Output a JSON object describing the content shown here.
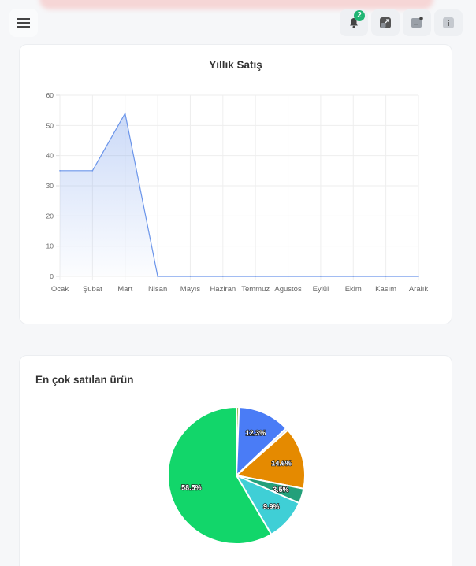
{
  "header": {
    "notification_count": "2",
    "icons": [
      "menu-icon",
      "bell-icon",
      "fullscreen-icon",
      "message-icon",
      "more-vertical-icon"
    ]
  },
  "line_card": {
    "title": "Yıllık Satış"
  },
  "pie_card": {
    "title": "En çok satılan ürün"
  },
  "colors": {
    "line": "#6b95ea",
    "grid": "#eeeeee",
    "axis_text": "#666666"
  },
  "chart_data": [
    {
      "type": "area",
      "title": "Yıllık Satış",
      "categories": [
        "Ocak",
        "Şubat",
        "Mart",
        "Nisan",
        "Mayıs",
        "Haziran",
        "Temmuz",
        "Agustos",
        "Eylül",
        "Ekim",
        "Kasım",
        "Aralık"
      ],
      "values": [
        35,
        35,
        54,
        0,
        0,
        0,
        0,
        0,
        0,
        0,
        0,
        0
      ],
      "ylim": [
        0,
        60
      ],
      "yticks": [
        0,
        10,
        20,
        30,
        40,
        50,
        60
      ],
      "grid": true,
      "legend": "none"
    },
    {
      "type": "pie",
      "title": "En çok satılan ürün",
      "slices": [
        {
          "value": 0.6,
          "label": "",
          "color": "#a2b85a"
        },
        {
          "value": 12.3,
          "label": "12.3%",
          "color": "#4a7cf6"
        },
        {
          "value": 0.6,
          "label": "",
          "color": "#e0e0e0"
        },
        {
          "value": 14.6,
          "label": "14.6%",
          "color": "#e58a00"
        },
        {
          "value": 3.5,
          "label": "3.5%",
          "color": "#23a07a"
        },
        {
          "value": 9.9,
          "label": "9.9%",
          "color": "#3fcfd6"
        },
        {
          "value": 58.5,
          "label": "58.5%",
          "color": "#12d66a"
        }
      ]
    }
  ]
}
